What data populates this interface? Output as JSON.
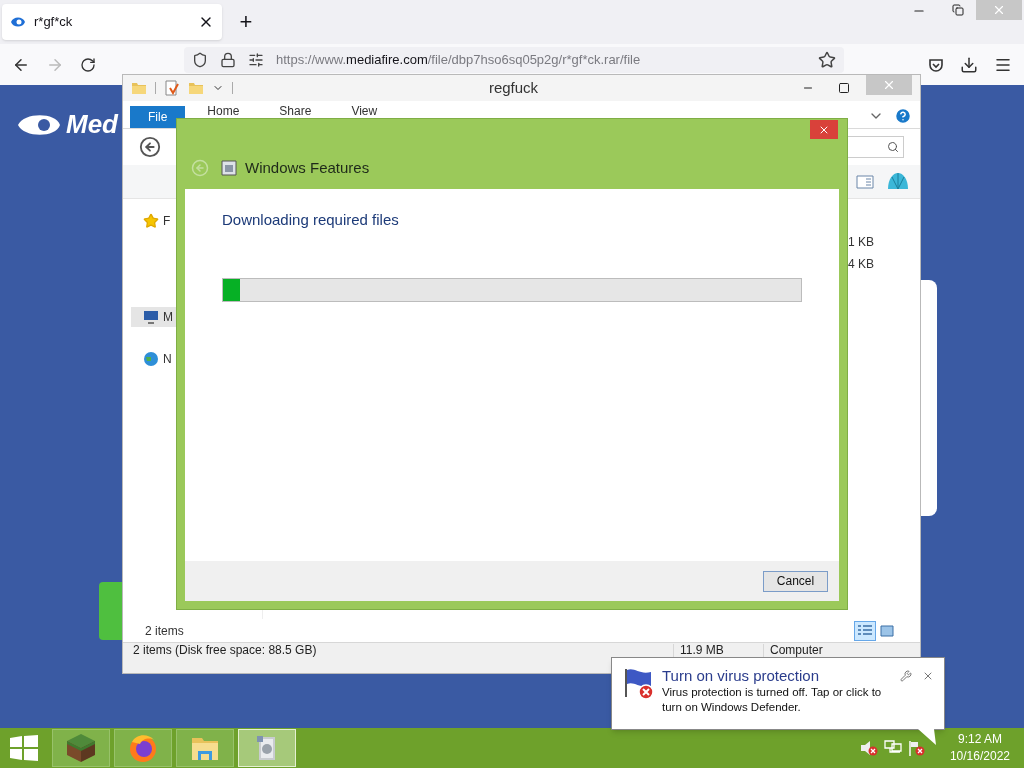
{
  "browser": {
    "tabs": [
      {
        "title": "r*gf*ck",
        "selected": true
      }
    ],
    "new_tab": "+",
    "url": {
      "scheme": "https://www.",
      "domain": "mediafire.com",
      "path": "/file/dbp7hso6sq05p2g/r*gf*ck.rar/file"
    }
  },
  "page": {
    "logo_text": "Med"
  },
  "explorer": {
    "title": "regfuck",
    "ribbon_tabs": [
      {
        "label": "File",
        "selected": true
      },
      {
        "label": "Home",
        "selected": false
      },
      {
        "label": "Share",
        "selected": false
      },
      {
        "label": "View",
        "selected": false
      }
    ],
    "nav_items": [
      {
        "label": "F",
        "selected": false
      },
      {
        "label": "M",
        "selected": true
      },
      {
        "label": "N",
        "selected": false
      }
    ],
    "file_sizes": [
      "1 KB",
      "4 KB"
    ],
    "item_count": "2 items",
    "views": [
      {
        "kind": "details",
        "selected": true
      },
      {
        "kind": "large-icons",
        "selected": false
      }
    ],
    "status_bar": {
      "summary": "2 items (Disk free space: 88.5 GB)",
      "size": "11.9 MB",
      "location": "Computer"
    }
  },
  "dialog": {
    "title": "Windows Features",
    "heading": "Downloading required files",
    "progress": {
      "level": 0.03
    },
    "cancel": "Cancel"
  },
  "notification": {
    "title": "Turn on virus protection",
    "body": "Virus protection is turned off. Tap or click to turn on Windows Defender."
  },
  "taskbar": {
    "apps": [
      {
        "kind": "minecraft",
        "selected": false
      },
      {
        "kind": "firefox",
        "selected": false
      },
      {
        "kind": "explorer",
        "selected": false
      },
      {
        "kind": "installer",
        "selected": true
      }
    ],
    "clock": {
      "time": "9:12 AM",
      "date": "10/16/2022"
    }
  }
}
